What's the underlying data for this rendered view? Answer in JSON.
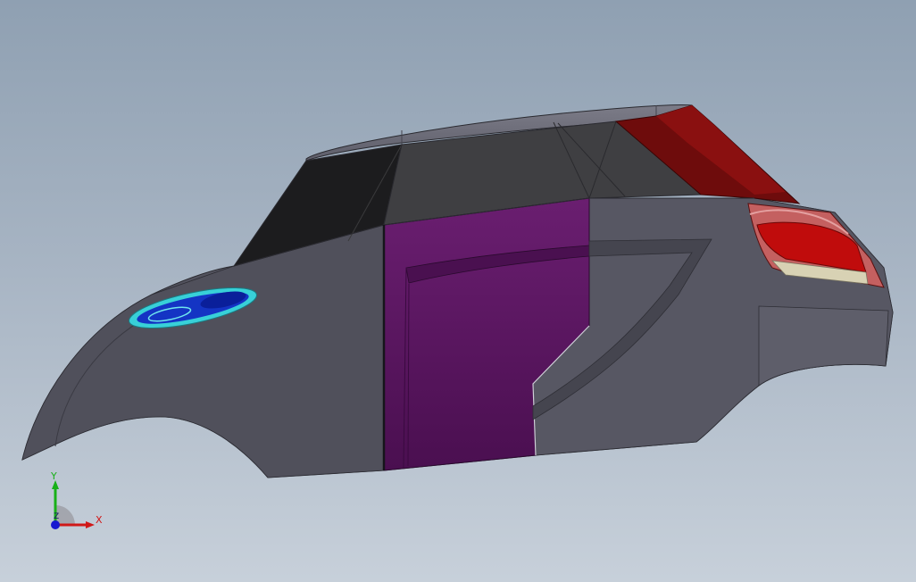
{
  "viewport": {
    "background_top": "#8fa0b2",
    "background_bottom": "#c7d0da"
  },
  "model": {
    "parts": [
      "body-shell",
      "roof",
      "front-windshield",
      "side-window",
      "rear-window",
      "front-door-panel",
      "rear-door-panel",
      "headlight",
      "tail-light"
    ],
    "colors": {
      "body": "#5a5a66",
      "body_dark": "#474752",
      "glass": "#3c3c3e",
      "glass_dark": "#1e1e20",
      "door": "#5d1a62",
      "tail_glass": "#7a0d0d",
      "tail_light": "#c40e0e",
      "headlight_blue": "#1030c8",
      "headlight_cyan": "#38d0d8"
    }
  },
  "triad": {
    "x_label": "X",
    "y_label": "Y",
    "z_label": "Z",
    "x_color": "#d01818",
    "y_color": "#18b018",
    "z_color": "#1818d0"
  }
}
